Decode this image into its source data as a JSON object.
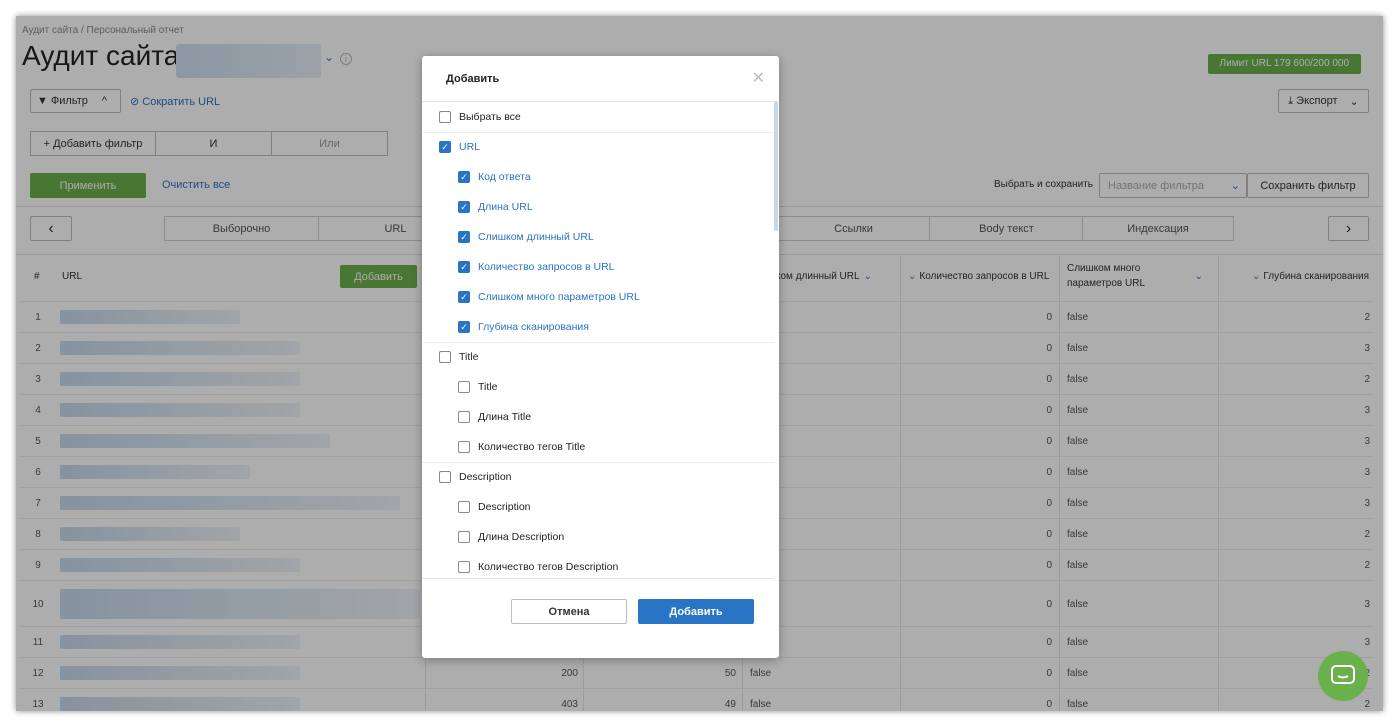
{
  "header": {
    "breadcrumb": "Аудит сайта / Персональный отчет",
    "title": "Аудит сайта",
    "limit_badge": "Лимит URL 179 600/200 000"
  },
  "toolbar": {
    "filter_label": "Фильтр",
    "shorten_url": "Сократить URL",
    "export_label": "Экспорт",
    "add_filter": "+ Добавить фильтр",
    "and_label": "И",
    "or_label": "Или",
    "apply": "Применить",
    "clear_all": "Очистить все",
    "choose_save": "Выбрать и сохранить",
    "filter_name_placeholder": "Название фильтра",
    "save_filter": "Сохранить фильтр"
  },
  "tabs": [
    "Выборочно",
    "URL",
    "Ссылки",
    "Body текст",
    "Индексация"
  ],
  "table": {
    "headers": {
      "num": "#",
      "url": "URL",
      "add_button": "Добавить",
      "too_long": "ком длинный URL",
      "query_count": "Количество запросов в URL",
      "too_many_params": "Слишком много параметров URL",
      "depth": "Глубина сканирования"
    },
    "rows": [
      {
        "n": "1",
        "code": "",
        "len": "",
        "long": "",
        "q": "0",
        "params": "false",
        "depth": "2"
      },
      {
        "n": "2",
        "code": "",
        "len": "",
        "long": "",
        "q": "0",
        "params": "false",
        "depth": "3"
      },
      {
        "n": "3",
        "code": "",
        "len": "",
        "long": "",
        "q": "0",
        "params": "false",
        "depth": "2"
      },
      {
        "n": "4",
        "code": "",
        "len": "",
        "long": "",
        "q": "0",
        "params": "false",
        "depth": "3"
      },
      {
        "n": "5",
        "code": "",
        "len": "",
        "long": "",
        "q": "0",
        "params": "false",
        "depth": "3"
      },
      {
        "n": "6",
        "code": "",
        "len": "",
        "long": "",
        "q": "0",
        "params": "false",
        "depth": "3"
      },
      {
        "n": "7",
        "code": "",
        "len": "",
        "long": "",
        "q": "0",
        "params": "false",
        "depth": "3"
      },
      {
        "n": "8",
        "code": "",
        "len": "",
        "long": "",
        "q": "0",
        "params": "false",
        "depth": "2"
      },
      {
        "n": "9",
        "code": "",
        "len": "",
        "long": "",
        "q": "0",
        "params": "false",
        "depth": "2"
      },
      {
        "n": "10",
        "code": "",
        "len": "",
        "long": "",
        "q": "0",
        "params": "false",
        "depth": "3"
      },
      {
        "n": "11",
        "code": "",
        "len": "",
        "long": "",
        "q": "0",
        "params": "false",
        "depth": "3"
      },
      {
        "n": "12",
        "code": "200",
        "len": "50",
        "long": "false",
        "q": "0",
        "params": "false",
        "depth": "2"
      },
      {
        "n": "13",
        "code": "403",
        "len": "49",
        "long": "false",
        "q": "0",
        "params": "false",
        "depth": "2"
      }
    ]
  },
  "modal": {
    "title": "Добавить",
    "select_all": "Выбрать все",
    "groups": [
      {
        "label": "URL",
        "checked": true,
        "items": [
          {
            "label": "Код ответа",
            "checked": true
          },
          {
            "label": "Длина URL",
            "checked": true
          },
          {
            "label": "Слишком длинный URL",
            "checked": true
          },
          {
            "label": "Количество запросов в URL",
            "checked": true
          },
          {
            "label": "Слишком много параметров URL",
            "checked": true
          },
          {
            "label": "Глубина сканирования",
            "checked": true
          }
        ]
      },
      {
        "label": "Title",
        "checked": false,
        "items": [
          {
            "label": "Title",
            "checked": false
          },
          {
            "label": "Длина Title",
            "checked": false
          },
          {
            "label": "Количество тегов Title",
            "checked": false
          }
        ]
      },
      {
        "label": "Description",
        "checked": false,
        "items": [
          {
            "label": "Description",
            "checked": false
          },
          {
            "label": "Длина Description",
            "checked": false
          },
          {
            "label": "Количество тегов Description",
            "checked": false
          }
        ]
      }
    ],
    "cancel": "Отмена",
    "add": "Добавить"
  },
  "colors": {
    "accent": "#2a74c5",
    "green": "#6ab04c"
  }
}
